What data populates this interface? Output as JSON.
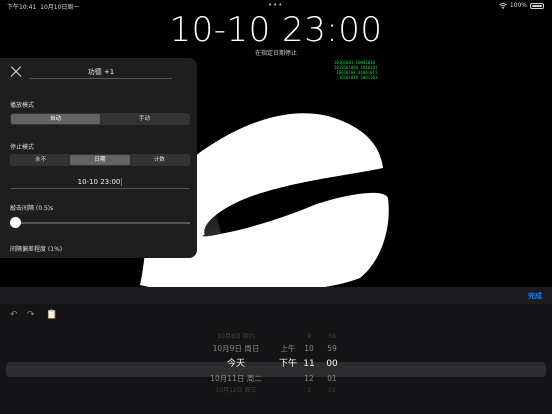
{
  "status_bar": {
    "time": "下午10:41",
    "date": "10月10日周一",
    "wifi_icon": "wifi-icon",
    "battery": "100%",
    "dots": "•••"
  },
  "clock": {
    "display": "10-10  23:00",
    "subtitle": "在指定日期停止"
  },
  "code_decoration": "10101001 10001010\n1010101010 1010101\n 10010101 01001011\n  10101010 1001101",
  "panel": {
    "title_value": "功德 +1",
    "play_mode": {
      "label": "播放模式",
      "options": [
        "自动",
        "手动"
      ],
      "selected": 0
    },
    "stop_mode": {
      "label": "停止模式",
      "options": [
        "永不",
        "日期",
        "计数"
      ],
      "selected": 1
    },
    "date_value": "10-10  23:00",
    "tap_interval": {
      "label": "敲击间隔 (0.5)s"
    },
    "deviation_label": "间隔偏差程度 (1%)"
  },
  "keyboard_toolbar": {
    "done_label": "完成",
    "undo_icon": "undo-icon",
    "redo_icon": "redo-icon",
    "paste_icon": "clipboard-icon"
  },
  "date_picker": {
    "date_column": [
      "10月8日 周六",
      "10月9日 周日",
      "今天",
      "10月11日 周二",
      "10月12日 周三"
    ],
    "ampm_column": [
      "",
      "上午",
      "下午",
      "",
      ""
    ],
    "hour_column": [
      "9",
      "10",
      "11",
      "12",
      "1"
    ],
    "minute_column": [
      "58",
      "59",
      "00",
      "01",
      "02"
    ],
    "selected_index": 2
  }
}
